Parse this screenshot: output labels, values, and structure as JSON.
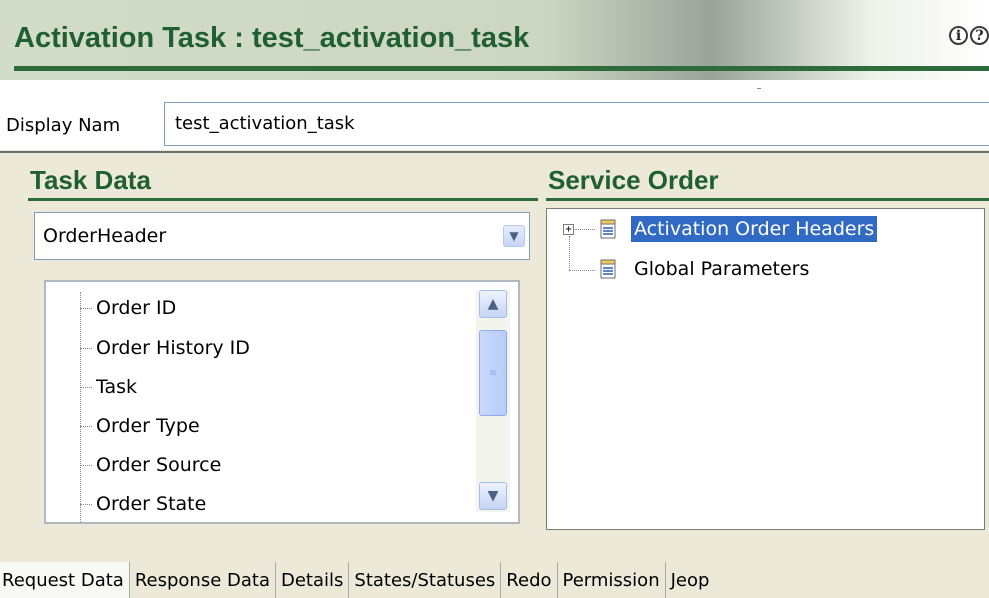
{
  "header": {
    "title": "Activation Task : test_activation_task",
    "info_icon": "info-icon",
    "help_icon": "help-icon"
  },
  "display_name": {
    "label": "Display Nam",
    "value": "test_activation_task"
  },
  "task_data": {
    "title": "Task Data",
    "combo_value": "OrderHeader",
    "items": [
      {
        "label": "Order ID"
      },
      {
        "label": "Order History ID"
      },
      {
        "label": "Task"
      },
      {
        "label": "Order Type"
      },
      {
        "label": "Order Source"
      },
      {
        "label": "Order State"
      }
    ]
  },
  "service_order": {
    "title": "Service Order",
    "items": [
      {
        "label": "Activation Order Headers",
        "selected": true,
        "expandable": true
      },
      {
        "label": "Global Parameters",
        "selected": false,
        "expandable": false
      }
    ]
  },
  "tabs": [
    {
      "label": "Request Data",
      "active": true
    },
    {
      "label": "Response Data",
      "active": false
    },
    {
      "label": "Details",
      "active": false
    },
    {
      "label": "States/Statuses",
      "active": false
    },
    {
      "label": "Redo",
      "active": false
    },
    {
      "label": "Permission",
      "active": false
    },
    {
      "label": "Jeop",
      "active": false
    }
  ],
  "colors": {
    "title_green": "#1f5f32",
    "rule_green": "#2e6b3a",
    "selection_blue": "#316ac5"
  }
}
